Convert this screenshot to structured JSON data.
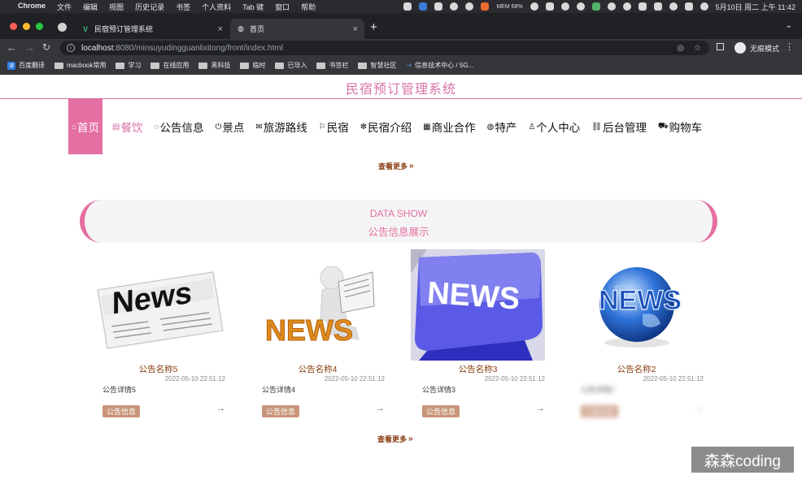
{
  "menubar": {
    "app": "Chrome",
    "menus": [
      "文件",
      "编辑",
      "视图",
      "历史记录",
      "书签",
      "个人资料",
      "Tab 键",
      "窗口",
      "帮助"
    ],
    "battery_small": "MEM 68%",
    "clock": "5月10日 周二 上午 11:42"
  },
  "tabs": [
    {
      "title": "民宿预订管理系统",
      "icon": "vue-logo-icon",
      "close": "×"
    },
    {
      "title": "首页",
      "icon": "globe-icon",
      "close": "×"
    }
  ],
  "toolbar": {
    "url_host": "localhost",
    "url_rest": ":8080/minsuyudingguanlixitong/front/index.html",
    "profile_label": "无痕模式"
  },
  "bookmarks": [
    "百度翻译",
    "macbook常用",
    "学习",
    "在线应用",
    "黑科技",
    "临时",
    "已导入",
    "书签栏",
    "智慧社区",
    "信息技术中心 / 5G..."
  ],
  "site": {
    "title": "民宿预订管理系统",
    "nav": [
      {
        "label": "首页",
        "icon": "home-icon",
        "glyph": "⌂"
      },
      {
        "label": "餐饮",
        "icon": "food-icon",
        "glyph": "▤"
      },
      {
        "label": "公告信息",
        "icon": "chat-icon",
        "glyph": "◌"
      },
      {
        "label": "景点",
        "icon": "power-icon",
        "glyph": "⏻"
      },
      {
        "label": "旅游路线",
        "icon": "mail-icon",
        "glyph": "✉"
      },
      {
        "label": "民宿",
        "icon": "flag-icon",
        "glyph": "⚐"
      },
      {
        "label": "民宿介绍",
        "icon": "snowflake-icon",
        "glyph": "✻"
      },
      {
        "label": "商业合作",
        "icon": "calendar-icon",
        "glyph": "▦"
      },
      {
        "label": "特产",
        "icon": "globe-icon",
        "glyph": "◍"
      },
      {
        "label": "个人中心",
        "icon": "user-icon",
        "glyph": "♙"
      },
      {
        "label": "后台管理",
        "icon": "link-icon",
        "glyph": "⛓"
      },
      {
        "label": "购物车",
        "icon": "cart-icon",
        "glyph": "⛟"
      }
    ],
    "more_label": "查看更多",
    "section_en": "DATA SHOW",
    "section_cn": "公告信息展示",
    "cards": [
      {
        "name": "公告名称5",
        "date": "2022-05-10 22:51:12",
        "detail": "公告详情5",
        "badge": "公告信息",
        "image": "newspaper-icon"
      },
      {
        "name": "公告名称4",
        "date": "2022-05-10 22:51:12",
        "detail": "公告详情4",
        "badge": "公告信息",
        "image": "reading-figure-icon"
      },
      {
        "name": "公告名称3",
        "date": "2022-05-10 22:51:12",
        "detail": "公告详情3",
        "badge": "公告信息",
        "image": "news-key-icon"
      },
      {
        "name": "公告名称2",
        "date": "2022-05-10 22:51:12",
        "detail": "公告详情2",
        "badge": "公告信息",
        "image": "news-globe-icon"
      }
    ],
    "watermark": "森森coding"
  }
}
